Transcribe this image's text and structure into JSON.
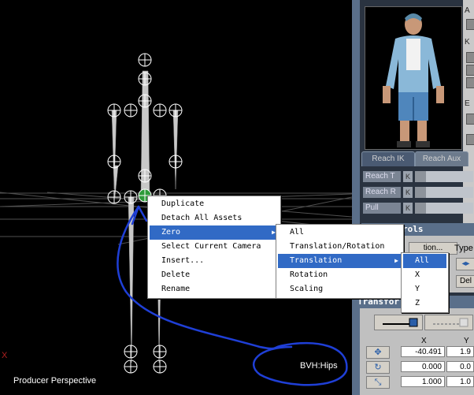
{
  "viewport": {
    "label": "Producer Perspective",
    "selected_bone": "BVH:Hips",
    "axis_marker": "X"
  },
  "context_menu": {
    "items": [
      {
        "label": "Duplicate"
      },
      {
        "label": "Detach All Assets"
      },
      {
        "label": "Zero",
        "selected": true,
        "submenu": true
      },
      {
        "label": "Select Current Camera"
      },
      {
        "label": "Insert..."
      },
      {
        "label": "Delete"
      },
      {
        "label": "Rename"
      }
    ]
  },
  "zero_submenu": {
    "items": [
      {
        "label": "All"
      },
      {
        "label": "Translation/Rotation"
      },
      {
        "label": "Translation",
        "selected": true,
        "submenu": true
      },
      {
        "label": "Rotation"
      },
      {
        "label": "Scaling"
      }
    ]
  },
  "translation_submenu": {
    "items": [
      {
        "label": "All",
        "selected": true
      },
      {
        "label": "X"
      },
      {
        "label": "Y"
      },
      {
        "label": "Z"
      }
    ]
  },
  "right_panel": {
    "tabs": [
      "Reach IK",
      "Reach Aux"
    ],
    "active_tab": "Reach IK",
    "side_letters": [
      "A",
      "K",
      "E"
    ],
    "rows": [
      {
        "label": "Reach T",
        "k": "K"
      },
      {
        "label": "Reach R",
        "k": "K"
      },
      {
        "label": "Pull",
        "k": "K"
      }
    ],
    "controls_header": "rols",
    "controls": {
      "dropdown_partial": "tion...",
      "type_label": "Type",
      "del_button": "Del"
    },
    "transform_header": "Transfor",
    "transform_table": {
      "columns": [
        "X",
        "Y"
      ],
      "rows": [
        {
          "icon": "move-icon",
          "x": "-40.491",
          "y": "1.9"
        },
        {
          "icon": "rotate-icon",
          "x": "0.000",
          "y": "0.0"
        },
        {
          "icon": "scale-icon",
          "x": "1.000",
          "y": "1.0"
        }
      ]
    }
  },
  "colors": {
    "menu_highlight": "#316ac5",
    "panel_header": "#5a6f8a",
    "annotation": "#1f3fd6",
    "bone": "#c8c8c8",
    "selected_joint": "#2e9b3a"
  }
}
